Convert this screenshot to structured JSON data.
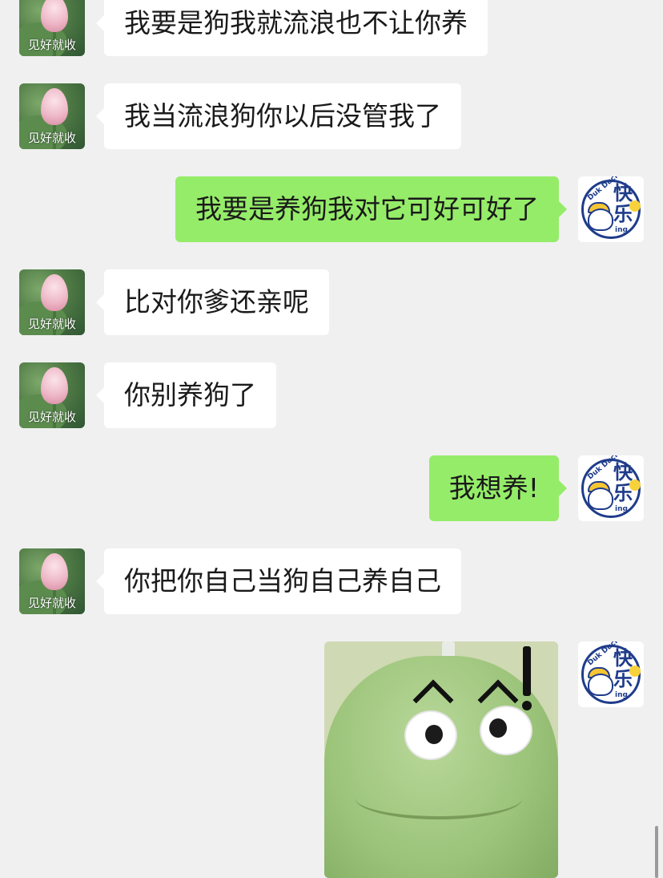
{
  "contacts": {
    "left_avatar_caption": "见好就收",
    "right_avatar_label_small": "Duk Duck",
    "right_avatar_label_big": "快乐",
    "right_avatar_label_tail": "ing"
  },
  "messages": [
    {
      "side": "left",
      "text": "我要是狗我就流浪也不让你养"
    },
    {
      "side": "left",
      "text": "我当流浪狗你以后没管我了"
    },
    {
      "side": "right",
      "text": "我要是养狗我对它可好可好了"
    },
    {
      "side": "left",
      "text": "比对你爹还亲呢"
    },
    {
      "side": "left",
      "text": "你别养狗了"
    },
    {
      "side": "right",
      "text": "我想养!"
    },
    {
      "side": "left",
      "text": "你把你自己当狗自己养自己"
    },
    {
      "side": "right",
      "type": "sticker",
      "sticker": "frog-sticker"
    }
  ],
  "colors": {
    "background": "#f0f0f0",
    "left_bubble": "#ffffff",
    "right_bubble": "#95ec69",
    "text": "#1a1a1a"
  }
}
